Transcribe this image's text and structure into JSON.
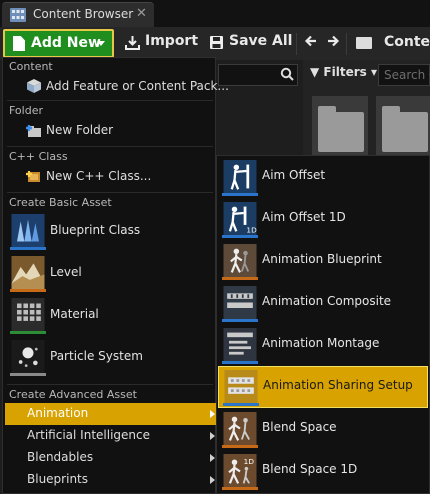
{
  "tab": {
    "title": "Content Browser",
    "close_glyph": "✕",
    "icon": "content-browser-icon"
  },
  "toolbar": {
    "add_new_label": "Add New",
    "import_label": "Import",
    "save_all_label": "Save All",
    "back_glyph": "🡐",
    "forward_glyph": "➜",
    "path_label": "Content",
    "accent_color": "#1f8e1f",
    "highlight_border": "#e5c84a"
  },
  "filters": {
    "label": "Filters",
    "search_placeholder": "Search Co"
  },
  "menu": {
    "content_header": "Content",
    "add_feature": "Add Feature or Content Pack...",
    "folder_header": "Folder",
    "new_folder": "New Folder",
    "cpp_header": "C++ Class",
    "new_cpp": "New C++ Class...",
    "basic_header": "Create Basic Asset",
    "basic_items": [
      "Blueprint Class",
      "Level",
      "Material",
      "Particle System"
    ],
    "advanced_header": "Create Advanced Asset",
    "advanced_items": [
      "Animation",
      "Artificial Intelligence",
      "Blendables",
      "Blueprints"
    ],
    "active_color": "#d8a200"
  },
  "submenu": {
    "items": [
      "Aim Offset",
      "Aim Offset 1D",
      "Animation Blueprint",
      "Animation Composite",
      "Animation Montage",
      "Animation Sharing Setup",
      "Blend Space",
      "Blend Space 1D"
    ],
    "highlighted": "Animation Sharing Setup"
  }
}
